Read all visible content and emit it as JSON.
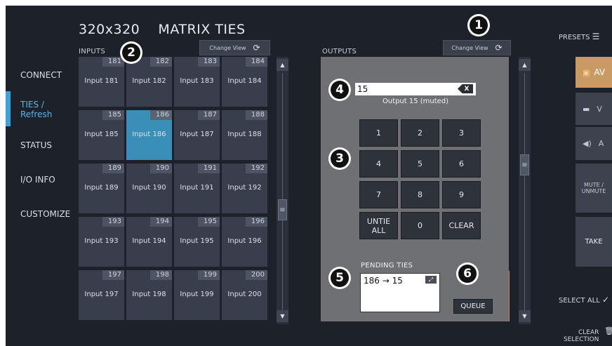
{
  "header": {
    "title": "320x320    MATRIX TIES"
  },
  "nav": {
    "items": [
      {
        "label": "CONNECT"
      },
      {
        "label": "TIES /\nRefresh",
        "active": true
      },
      {
        "label": "STATUS"
      },
      {
        "label": "I/O INFO"
      },
      {
        "label": "CUSTOMIZE"
      }
    ]
  },
  "inputs": {
    "label": "INPUTS",
    "change_view": "Change View",
    "cells": [
      {
        "num": "181",
        "label": "Input 181"
      },
      {
        "num": "182",
        "label": "Input 182"
      },
      {
        "num": "183",
        "label": "Input 183"
      },
      {
        "num": "184",
        "label": "Input 184"
      },
      {
        "num": "185",
        "label": "Input 185"
      },
      {
        "num": "186",
        "label": "Input 186",
        "selected": true
      },
      {
        "num": "187",
        "label": "Input 187"
      },
      {
        "num": "188",
        "label": "Input 188"
      },
      {
        "num": "189",
        "label": "Input 189"
      },
      {
        "num": "190",
        "label": "Input 190"
      },
      {
        "num": "191",
        "label": "Input 191"
      },
      {
        "num": "192",
        "label": "Input 192"
      },
      {
        "num": "193",
        "label": "Input 193"
      },
      {
        "num": "194",
        "label": "Input 194"
      },
      {
        "num": "195",
        "label": "Input 195"
      },
      {
        "num": "196",
        "label": "Input 196"
      },
      {
        "num": "197",
        "label": "Input 197"
      },
      {
        "num": "198",
        "label": "Input 198"
      },
      {
        "num": "199",
        "label": "Input 199"
      },
      {
        "num": "200",
        "label": "Input 200"
      }
    ]
  },
  "outputs": {
    "label": "OUTPUTS",
    "change_view": "Change View"
  },
  "keypad": {
    "value": "15",
    "backspace": "X",
    "description": "Output 15 (muted)",
    "keys": [
      "1",
      "2",
      "3",
      "4",
      "5",
      "6",
      "7",
      "8",
      "9",
      "UNTIE\nALL",
      "0",
      "CLEAR"
    ],
    "pending_label": "PENDING TIES",
    "pending_text": "186 → 15",
    "queue": "QUEUE"
  },
  "callouts": [
    "1",
    "2",
    "3",
    "4",
    "5",
    "6"
  ],
  "right": {
    "presets": "PRESETS",
    "av": "AV",
    "v": "V",
    "a": "A",
    "mute": "MUTE /\nUNMUTE",
    "take": "TAKE",
    "select_all": "SELECT ALL",
    "clear_selection": "CLEAR\nSELECTION"
  },
  "colors": {
    "accent": "#3aa3dc",
    "selected_cell": "#3a8fb8",
    "av_button": "#c99a64"
  }
}
